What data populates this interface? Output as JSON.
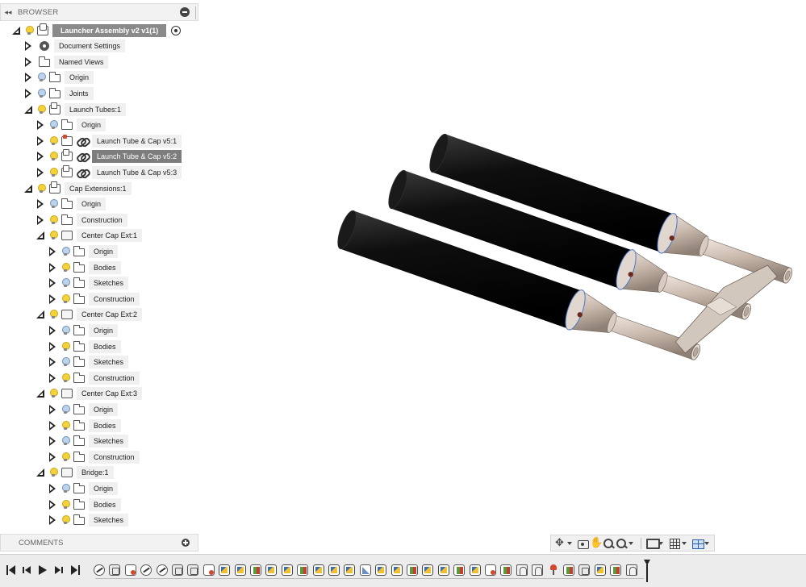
{
  "browser": {
    "title": "BROWSER",
    "collapse_icon": "double-chevron-left-icon",
    "items": [
      {
        "label": "Launcher Assembly v2 v1(1)",
        "indent": 0,
        "tri": "open",
        "bulb": "yellow",
        "icon": "assembly",
        "style": "root",
        "radio": true
      },
      {
        "label": "Document Settings",
        "indent": 1,
        "tri": "closed",
        "bulb": "",
        "icon": "gear"
      },
      {
        "label": "Named Views",
        "indent": 1,
        "tri": "closed",
        "bulb": "",
        "icon": "folder"
      },
      {
        "label": "Origin",
        "indent": 1,
        "tri": "closed",
        "bulb": "blue",
        "icon": "folder"
      },
      {
        "label": "Joints",
        "indent": 1,
        "tri": "closed",
        "bulb": "blue",
        "icon": "folder"
      },
      {
        "label": "Launch Tubes:1",
        "indent": 1,
        "tri": "open",
        "bulb": "yellow",
        "icon": "component"
      },
      {
        "label": "Origin",
        "indent": 2,
        "tri": "closed",
        "bulb": "blue",
        "icon": "folder"
      },
      {
        "label": "Launch Tube & Cap v5:1",
        "indent": 2,
        "tri": "closed",
        "bulb": "yellow",
        "icon": "part-red",
        "link": true
      },
      {
        "label": "Launch Tube & Cap v5:2",
        "indent": 2,
        "tri": "closed",
        "bulb": "yellow",
        "icon": "component",
        "link": true,
        "style": "sel"
      },
      {
        "label": "Launch Tube & Cap v5:3",
        "indent": 2,
        "tri": "closed",
        "bulb": "yellow",
        "icon": "component",
        "link": true
      },
      {
        "label": "Cap Extensions:1",
        "indent": 1,
        "tri": "open",
        "bulb": "yellow",
        "icon": "component"
      },
      {
        "label": "Origin",
        "indent": 2,
        "tri": "closed",
        "bulb": "blue",
        "icon": "folder"
      },
      {
        "label": "Construction",
        "indent": 2,
        "tri": "closed",
        "bulb": "yellow",
        "icon": "folder"
      },
      {
        "label": "Center Cap Ext:1",
        "indent": 2,
        "tri": "open",
        "bulb": "yellow",
        "icon": "body"
      },
      {
        "label": "Origin",
        "indent": 3,
        "tri": "closed",
        "bulb": "blue",
        "icon": "folder"
      },
      {
        "label": "Bodies",
        "indent": 3,
        "tri": "closed",
        "bulb": "yellow",
        "icon": "folder"
      },
      {
        "label": "Sketches",
        "indent": 3,
        "tri": "closed",
        "bulb": "blue",
        "icon": "folder"
      },
      {
        "label": "Construction",
        "indent": 3,
        "tri": "closed",
        "bulb": "yellow",
        "icon": "folder"
      },
      {
        "label": "Center Cap Ext:2",
        "indent": 2,
        "tri": "open",
        "bulb": "yellow",
        "icon": "body"
      },
      {
        "label": "Origin",
        "indent": 3,
        "tri": "closed",
        "bulb": "blue",
        "icon": "folder"
      },
      {
        "label": "Bodies",
        "indent": 3,
        "tri": "closed",
        "bulb": "yellow",
        "icon": "folder"
      },
      {
        "label": "Sketches",
        "indent": 3,
        "tri": "closed",
        "bulb": "blue",
        "icon": "folder"
      },
      {
        "label": "Construction",
        "indent": 3,
        "tri": "closed",
        "bulb": "yellow",
        "icon": "folder"
      },
      {
        "label": "Center Cap Ext:3",
        "indent": 2,
        "tri": "open",
        "bulb": "yellow",
        "icon": "body"
      },
      {
        "label": "Origin",
        "indent": 3,
        "tri": "closed",
        "bulb": "blue",
        "icon": "folder"
      },
      {
        "label": "Bodies",
        "indent": 3,
        "tri": "closed",
        "bulb": "yellow",
        "icon": "folder"
      },
      {
        "label": "Sketches",
        "indent": 3,
        "tri": "closed",
        "bulb": "blue",
        "icon": "folder"
      },
      {
        "label": "Construction",
        "indent": 3,
        "tri": "closed",
        "bulb": "yellow",
        "icon": "folder"
      },
      {
        "label": "Bridge:1",
        "indent": 2,
        "tri": "open",
        "bulb": "yellow",
        "icon": "body"
      },
      {
        "label": "Origin",
        "indent": 3,
        "tri": "closed",
        "bulb": "blue",
        "icon": "folder"
      },
      {
        "label": "Bodies",
        "indent": 3,
        "tri": "closed",
        "bulb": "yellow",
        "icon": "folder"
      },
      {
        "label": "Sketches",
        "indent": 3,
        "tri": "closed",
        "bulb": "yellow",
        "icon": "folder"
      }
    ]
  },
  "comments": {
    "title": "COMMENTS",
    "add_icon": "plus-circle-icon"
  },
  "nav_toolbar": {
    "items": [
      "orbit-icon",
      "caret-down-icon",
      "look-at-icon",
      "pan-icon",
      "zoom-icon",
      "zoom-window-icon",
      "caret-down-icon",
      "separator",
      "display-settings-icon",
      "caret-down-icon",
      "grid-icon",
      "caret-down-icon",
      "viewports-icon",
      "caret-down-icon"
    ]
  },
  "timeline": {
    "playback": [
      "go-to-start-icon",
      "step-back-icon",
      "play-icon",
      "step-forward-icon",
      "go-to-end-icon"
    ],
    "features": [
      "joint",
      "extrude",
      "red",
      "joint",
      "joint",
      "extrude",
      "extrude",
      "red",
      "sketch",
      "sketch",
      "green",
      "sketch",
      "sketch",
      "green",
      "sketch",
      "sketch",
      "sketch",
      "chamfer",
      "sketch",
      "sketch",
      "green",
      "sketch",
      "sketch",
      "green",
      "sketch",
      "red",
      "green",
      "loft",
      "loft",
      "pin",
      "green",
      "extrude",
      "sketch",
      "green",
      "loft"
    ]
  },
  "model": {
    "tube_color": "#111111",
    "cap_color": "#c9b9ad",
    "bridge_color": "#d2c7bd",
    "selection_edge_color": "#4a78c8"
  }
}
